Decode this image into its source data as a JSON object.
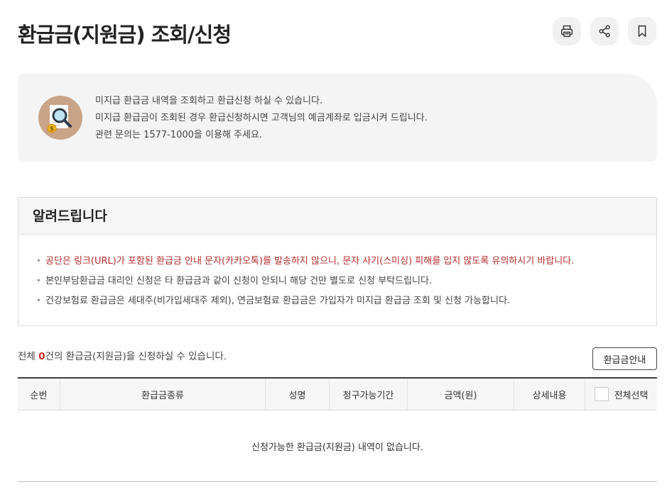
{
  "page": {
    "title": "환급금(지원금) 조회/신청"
  },
  "actions": {
    "print_icon": "printer-icon",
    "share_icon": "share-icon",
    "bookmark_icon": "bookmark-icon"
  },
  "intro": {
    "icon": "document-search-icon",
    "lines": [
      "미지급 환급금 내역을 조회하고 환급신청 하실 수 있습니다.",
      "미지급 환급금이 조회된 경우 환급신청하시면 고객님의 예금계좌로 입금시켜 드립니다.",
      "관련 문의는 1577-1000을 이용해 주세요."
    ]
  },
  "notice": {
    "title": "알려드립니다",
    "items": [
      "공단은 링크(URL)가 포함된 환급금 안내 문자(카카오톡)를 발송하지 않으니, 문자 사기(스미싱) 피해를 입지 않도록 유의하시기 바랍니다.",
      "본인부담환급금 대리인 신청은 타 환급금과 같이 신청이 안되니 해당 건만 별도로 신청 부탁드립니다.",
      "건강보험료 환급금은 세대주(비가입세대주 제외), 연금보험료 환급금은 가입자가 미지급 환급금 조회 및 신청 가능합니다."
    ],
    "alert_color": "#b32d2d"
  },
  "summary": {
    "prefix": "전체 ",
    "count": "0",
    "suffix": "건의 환급금(지원금)을 신청하실 수 있습니다.",
    "guide_button": "환급금안내"
  },
  "table": {
    "headers": [
      "순번",
      "환급금종류",
      "성명",
      "청구가능기간",
      "금액(원)",
      "상세내용"
    ],
    "select_all_label": "전체선택",
    "empty_message": "신청가능한 환급금(지원금) 내역이 없습니다."
  },
  "colors": {
    "accent_red": "#c62828",
    "table_top_border": "#3b3f4c"
  }
}
